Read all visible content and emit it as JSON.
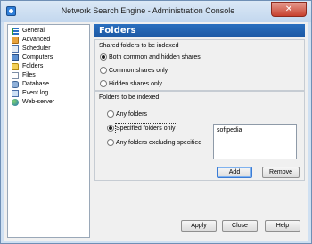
{
  "window": {
    "title": "Network Search Engine - Administration Console",
    "close_glyph": "✕",
    "icon": "app-icon"
  },
  "sidebar": {
    "items": [
      {
        "label": "General",
        "icon": "general-icon"
      },
      {
        "label": "Advanced",
        "icon": "advanced-icon"
      },
      {
        "label": "Scheduler",
        "icon": "scheduler-icon"
      },
      {
        "label": "Computers",
        "icon": "computers-icon"
      },
      {
        "label": "Folders",
        "icon": "folders-icon"
      },
      {
        "label": "Files",
        "icon": "files-icon"
      },
      {
        "label": "Database",
        "icon": "database-icon"
      },
      {
        "label": "Event log",
        "icon": "event-log-icon"
      },
      {
        "label": "Web-server",
        "icon": "web-server-icon"
      }
    ]
  },
  "main": {
    "header": "Folders",
    "shared_group": {
      "title": "Shared folders to be indexed",
      "options": [
        {
          "label": "Both common and hidden shares",
          "selected": true
        },
        {
          "label": "Common shares only",
          "selected": false
        },
        {
          "label": "Hidden shares only",
          "selected": false
        }
      ]
    },
    "folders_group": {
      "title": "Folders to be indexed",
      "options": [
        {
          "label": "Any folders",
          "selected": false
        },
        {
          "label": "Specified folders only",
          "selected": true
        },
        {
          "label": "Any folders excluding specified",
          "selected": false
        }
      ],
      "list_items": [
        "softpedia"
      ],
      "add_label": "Add",
      "remove_label": "Remove"
    }
  },
  "footer": {
    "apply_label": "Apply",
    "close_label": "Close",
    "help_label": "Help"
  },
  "colors": {
    "header_bg": "#1c58a3",
    "window_frame": "#c3d7ee",
    "close_button": "#c7402e"
  }
}
